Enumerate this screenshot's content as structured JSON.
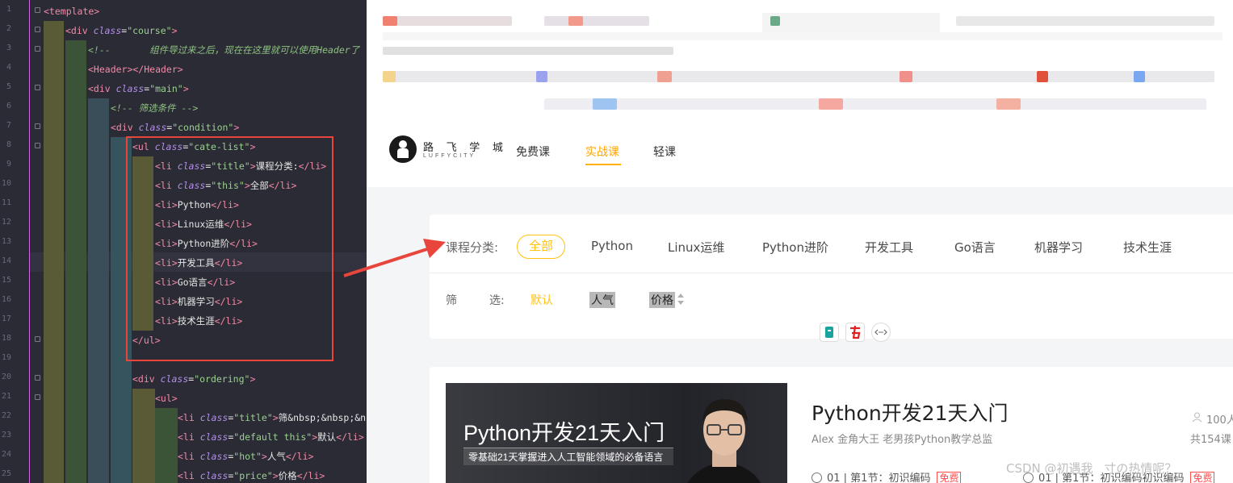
{
  "editor": {
    "line_numbers": [
      "1",
      "2",
      "3",
      "4",
      "5",
      "6",
      "7",
      "8",
      "9",
      "10",
      "11",
      "12",
      "13",
      "14",
      "15",
      "16",
      "17",
      "18",
      "19",
      "20",
      "21",
      "22",
      "23",
      "24",
      "25"
    ]
  },
  "browser": {
    "logo": {
      "cn": "路 飞 学 城",
      "en": "LUFFYCITY"
    },
    "nav": [
      {
        "label": "免费课",
        "active": false
      },
      {
        "label": "实战课",
        "active": true
      },
      {
        "label": "轻课",
        "active": false
      }
    ],
    "categories": {
      "label": "课程分类:",
      "items": [
        "全部",
        "Python",
        "Linux运维",
        "Python进阶",
        "开发工具",
        "Go语言",
        "机器学习",
        "技术生涯"
      ],
      "selected": "全部"
    },
    "ordering": {
      "label_a": "筛",
      "label_b": "选:",
      "default": "默认",
      "hot": "人气",
      "price": "价格"
    },
    "course": {
      "img_title": "Python开发21天入门",
      "img_subtitle": "零基础21天掌握进入人工智能领域的必备语言",
      "title": "Python开发21天入门",
      "teacher": "Alex 金角大王 老男孩Python教学总监",
      "students": "100人",
      "total": "共154课",
      "lesson1": "01 | 第1节：初识编码",
      "lesson2": "01 | 第1节：初识编码初识编码",
      "free": "免费"
    },
    "watermark": "CSDN @初遇我ㅤ寸の热情呢？"
  },
  "colors": {
    "accent": "#ffc210",
    "annotation_red": "#e8453c"
  }
}
